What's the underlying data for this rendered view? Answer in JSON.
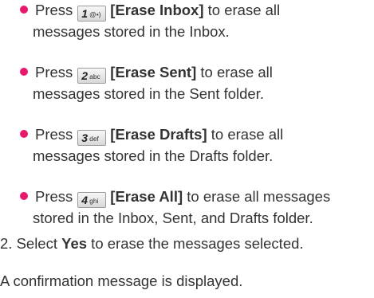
{
  "bullets": [
    {
      "press": "Press",
      "key_num": "1",
      "key_sym": "@•)",
      "label": "[Erase Inbox]",
      "rest": " to erase all",
      "line2": "messages stored in the Inbox."
    },
    {
      "press": "Press",
      "key_num": "2",
      "key_sym": "abc",
      "label": "[Erase Sent]",
      "rest": " to erase all",
      "line2": "messages stored in the Sent folder."
    },
    {
      "press": "Press",
      "key_num": "3",
      "key_sym": "def",
      "label": "[Erase Drafts]",
      "rest": " to erase all",
      "line2": "messages stored in the Drafts folder."
    },
    {
      "press": "Press",
      "key_num": "4",
      "key_sym": "ghi",
      "label": "[Erase All]",
      "rest": " to erase all messages",
      "line2": "stored in the Inbox, Sent, and Drafts folder."
    }
  ],
  "step2": {
    "prefix": "2. Select ",
    "bold": "Yes",
    "suffix": " to erase the messages selected."
  },
  "confirmation": "A confirmation message is displayed.",
  "colors": {
    "bullet": "#e8196c",
    "text": "#333333"
  }
}
